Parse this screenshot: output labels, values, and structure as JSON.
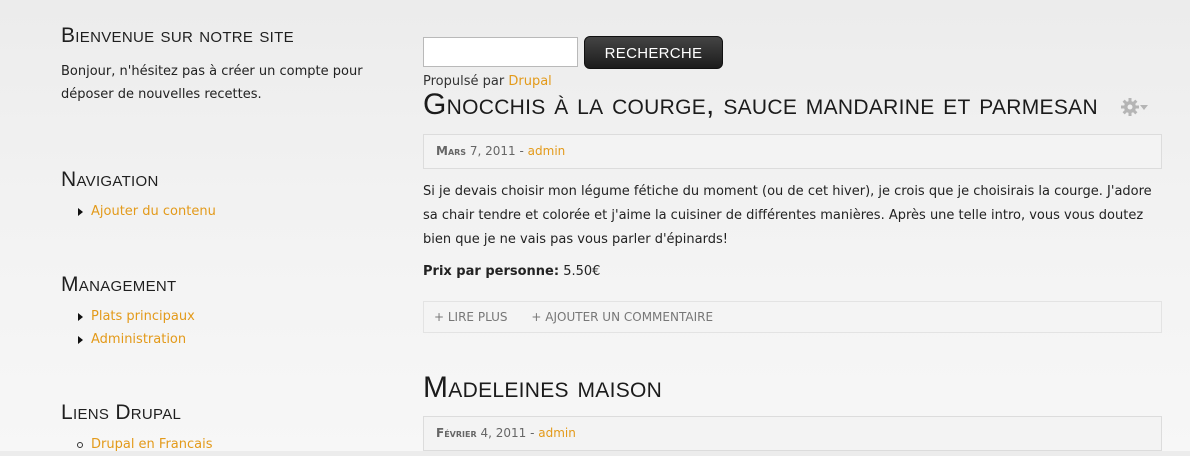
{
  "sidebar": {
    "welcome": {
      "title": "Bienvenue sur notre site",
      "text": "Bonjour, n'hésitez pas à créer un compte pour déposer de nouvelles recettes."
    },
    "navigation": {
      "title": "Navigation",
      "items": [
        "Ajouter du contenu"
      ]
    },
    "management": {
      "title": "Management",
      "items": [
        "Plats principaux",
        "Administration"
      ]
    },
    "drupal_links": {
      "title": "Liens Drupal",
      "items": [
        "Drupal en Francais"
      ]
    }
  },
  "search": {
    "input_value": "",
    "button_label": "RECHERCHE"
  },
  "powered_by": {
    "prefix": "Propulsé par",
    "link": "Drupal"
  },
  "articles": [
    {
      "title": "Gnocchis à la courge, sauce mandarine et parmesan",
      "month": "Mars",
      "date_rest": "7, 2011 -",
      "author": "admin",
      "body": "Si je devais choisir mon légume fétiche du moment (ou de cet hiver), je crois que je choisirais la courge. J'adore sa chair tendre et colorée et j'aime la cuisiner de différentes manières. Après une telle intro, vous vous doutez bien que je ne vais pas vous parler d'épinards!",
      "price_label": "Prix par personne:",
      "price_value": "5.50€",
      "read_more": "+ LIRE PLUS",
      "add_comment": "+ AJOUTER UN COMMENTAIRE"
    },
    {
      "title": "Madeleines maison",
      "month": "Février",
      "date_rest": "4, 2011 -",
      "author": "admin"
    }
  ],
  "colors": {
    "accent": "#e39a1a",
    "button_dark": "#222222"
  },
  "icons": {
    "contextual": "gear-icon"
  }
}
